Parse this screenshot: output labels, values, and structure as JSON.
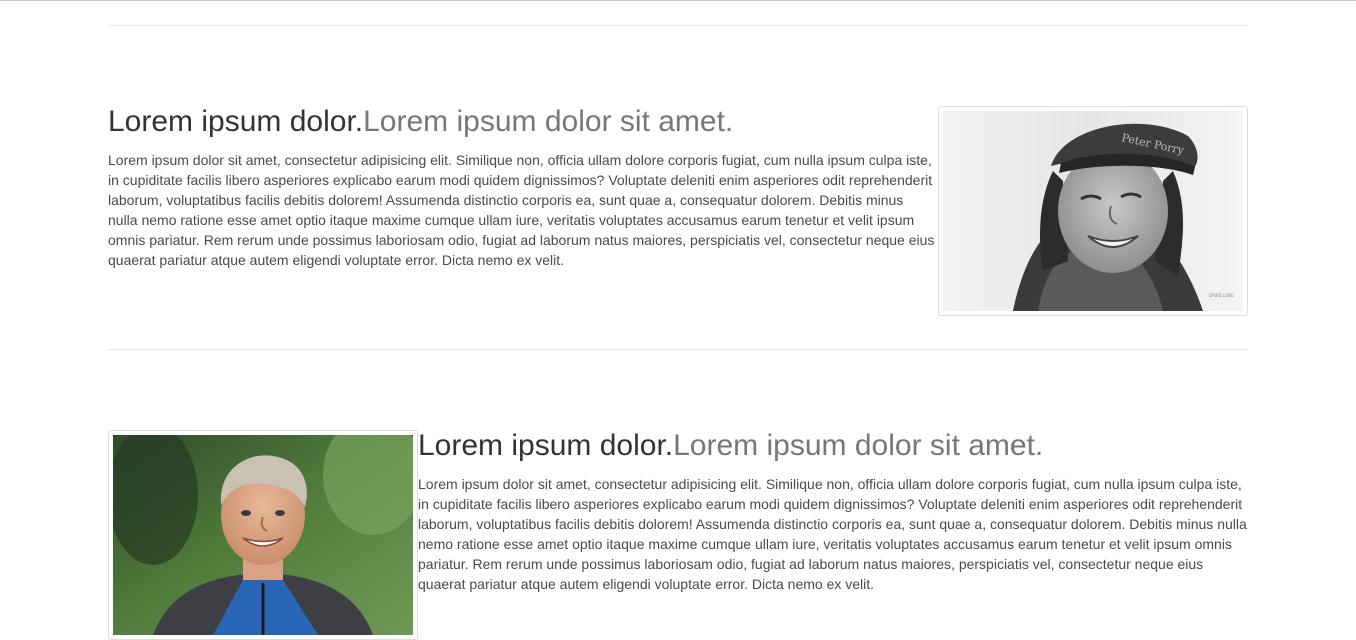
{
  "features": [
    {
      "heading": "Lorem ipsum dolor.",
      "heading_muted": "Lorem ipsum dolor sit amet.",
      "body": "Lorem ipsum dolor sit amet, consectetur adipisicing elit. Similique non, officia ullam dolore corporis fugiat, cum nulla ipsum culpa iste, in cupiditate facilis libero asperiores explicabo earum modi quidem dignissimos? Voluptate deleniti enim asperiores odit reprehenderit laborum, voluptatibus facilis debitis dolorem! Assumenda distinctio corporis ea, sunt quae a, consequatur dolorem. Debitis minus nulla nemo ratione esse amet optio itaque maxime cumque ullam iure, veritatis voluptates accusamus earum tenetur et velit ipsum omnis pariatur. Rem rerum unde possimus laboriosam odio, fugiat ad laborum natus maiores, perspiciatis vel, consectetur neque eius quaerat pariatur atque autem eligendi voluptate error. Dicta nemo ex velit."
    },
    {
      "heading": "Lorem ipsum dolor.",
      "heading_muted": "Lorem ipsum dolor sit amet.",
      "body": "Lorem ipsum dolor sit amet, consectetur adipisicing elit. Similique non, officia ullam dolore corporis fugiat, cum nulla ipsum culpa iste, in cupiditate facilis libero asperiores explicabo earum modi quidem dignissimos? Voluptate deleniti enim asperiores odit reprehenderit laborum, voluptatibus facilis debitis dolorem! Assumenda distinctio corporis ea, sunt quae a, consequatur dolorem. Debitis minus nulla nemo ratione esse amet optio itaque maxime cumque ullam iure, veritatis voluptates accusamus earum tenetur et velit ipsum omnis pariatur. Rem rerum unde possimus laboriosam odio, fugiat ad laborum natus maiores, perspiciatis vel, consectetur neque eius quaerat pariatur atque autem eligendi voluptate error. Dicta nemo ex velit."
    }
  ],
  "colors": {
    "heading": "#333333",
    "heading_muted": "#777777",
    "body_text": "#4a4a4a",
    "divider": "#e8e8e8"
  }
}
